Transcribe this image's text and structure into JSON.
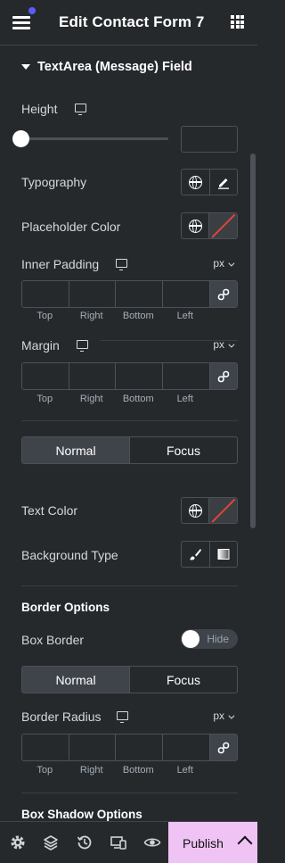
{
  "header": {
    "title": "Edit Contact Form 7",
    "menu_icon": "hamburger-menu-icon",
    "grid_icon": "widgets-grid-icon",
    "notification_color": "#5b5bf5"
  },
  "section": {
    "title": "TextArea (Message) Field"
  },
  "height": {
    "label": "Height",
    "device_icon": "desktop-icon",
    "slider_value": 0,
    "input_value": ""
  },
  "typography": {
    "label": "Typography",
    "global_icon": "globe-icon",
    "edit_icon": "pencil-icon"
  },
  "placeholder_color": {
    "label": "Placeholder Color",
    "global_icon": "globe-icon",
    "swatch": "none"
  },
  "inner_padding": {
    "label": "Inner Padding",
    "unit": "px",
    "labels": [
      "Top",
      "Right",
      "Bottom",
      "Left"
    ],
    "link_icon": "link-icon"
  },
  "margin": {
    "label": "Margin",
    "unit": "px",
    "labels": [
      "Top",
      "Right",
      "Bottom",
      "Left"
    ],
    "link_icon": "link-icon"
  },
  "state_tabs": {
    "normal": "Normal",
    "focus": "Focus",
    "active": "Normal"
  },
  "text_color": {
    "label": "Text Color",
    "swatch": "none"
  },
  "background_type": {
    "label": "Background Type",
    "options": [
      "brush-icon",
      "gradient-icon"
    ]
  },
  "border_options": {
    "title": "Border Options",
    "box_border_label": "Box Border",
    "toggle_label": "Hide",
    "tabs": {
      "normal": "Normal",
      "focus": "Focus",
      "active": "Normal"
    },
    "radius_label": "Border Radius",
    "radius_unit": "px",
    "radius_labels": [
      "Top",
      "Right",
      "Bottom",
      "Left"
    ]
  },
  "box_shadow": {
    "title": "Box Shadow Options"
  },
  "footer": {
    "icons": [
      "settings-gear-icon",
      "layers-icon",
      "history-icon",
      "responsive-icon",
      "preview-eye-icon"
    ],
    "publish_label": "Publish",
    "publish_color": "#f0c3f5"
  }
}
